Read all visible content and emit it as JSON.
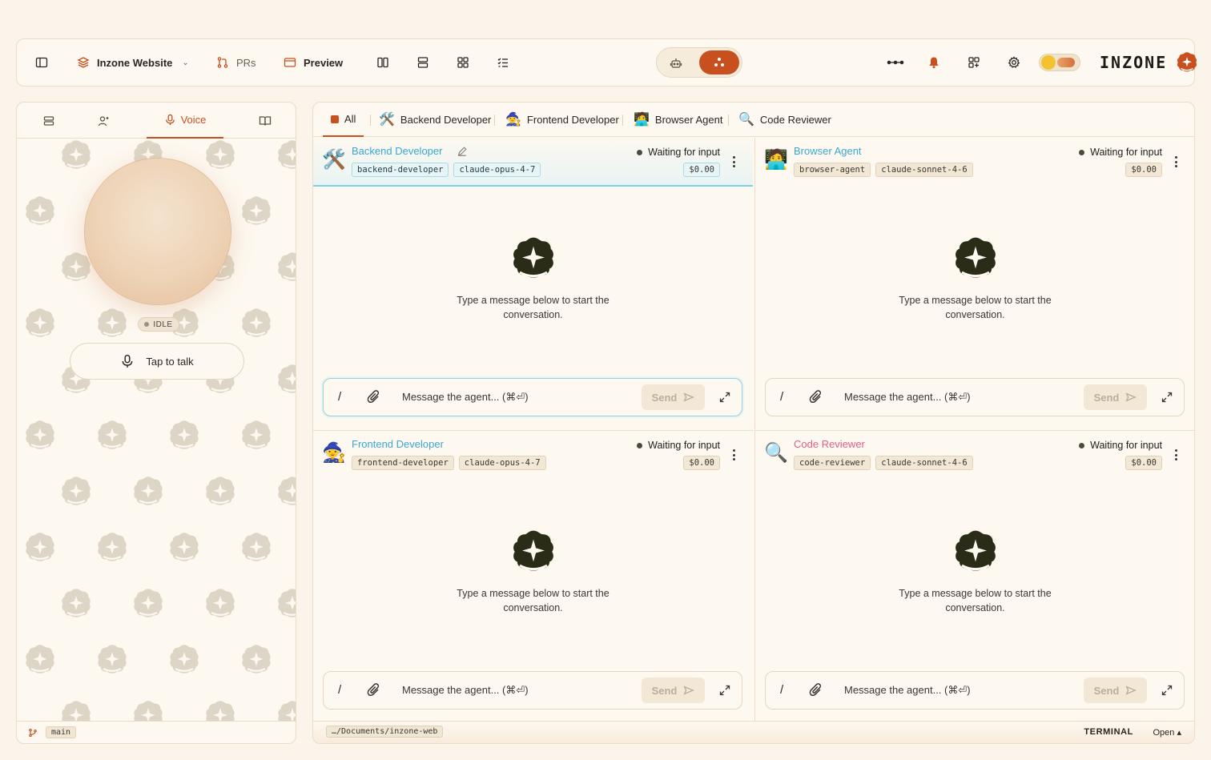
{
  "topbar": {
    "project": "Inzone Website",
    "prs": "PRs",
    "preview": "Preview",
    "brand": "INZONE",
    "accent": "#c8501e"
  },
  "leftpanel": {
    "voice_tab": "Voice",
    "status": "IDLE",
    "talk": "Tap to talk",
    "branch": "main"
  },
  "tabs": {
    "all": "All",
    "backend": "Backend Developer",
    "frontend": "Frontend Developer",
    "browser": "Browser Agent",
    "reviewer": "Code Reviewer"
  },
  "cards": [
    {
      "name": "Backend Developer",
      "slug": "backend-developer",
      "model": "claude-opus-4-7",
      "status": "Waiting for input",
      "cost": "$0.00",
      "emoji": "🛠️"
    },
    {
      "name": "Browser Agent",
      "slug": "browser-agent",
      "model": "claude-sonnet-4-6",
      "status": "Waiting for input",
      "cost": "$0.00",
      "emoji": "🧑‍💻"
    },
    {
      "name": "Frontend Developer",
      "slug": "frontend-developer",
      "model": "claude-opus-4-7",
      "status": "Waiting for input",
      "cost": "$0.00",
      "emoji": "🧙"
    },
    {
      "name": "Code Reviewer",
      "slug": "code-reviewer",
      "model": "claude-sonnet-4-6",
      "status": "Waiting for input",
      "cost": "$0.00",
      "emoji": "🔍"
    }
  ],
  "empty_text": "Type a message below to start the conversation.",
  "composer": {
    "slash": "/",
    "placeholder": "Message the agent... (⌘⏎)",
    "send": "Send"
  },
  "footer": {
    "path": "…/Documents/inzone-web",
    "terminal": "TERMINAL",
    "open": "Open ▴"
  }
}
